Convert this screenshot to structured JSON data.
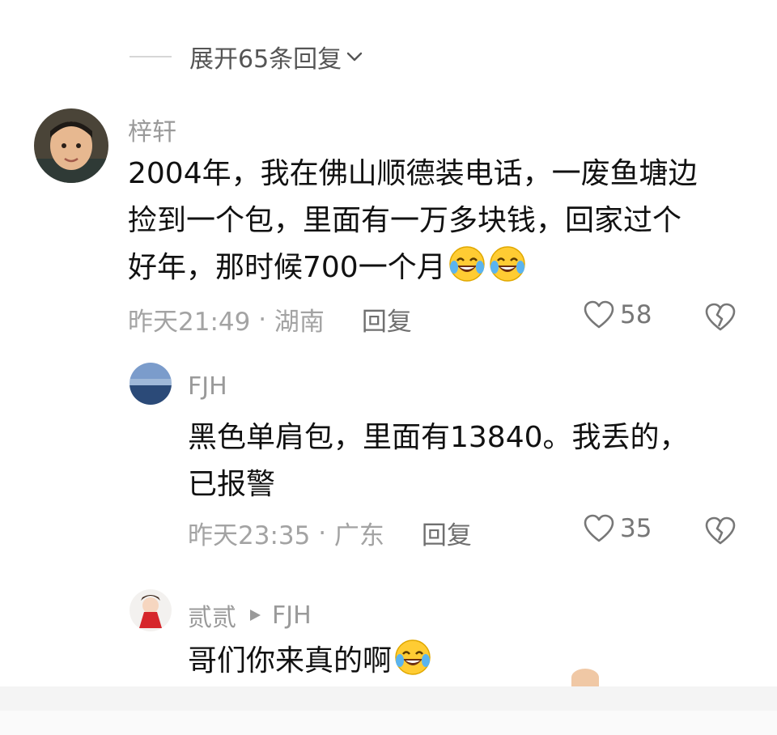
{
  "expand": {
    "label": "展开65条回复"
  },
  "comment": {
    "user": "梓轩",
    "text_lines": [
      "2004年，我在佛山顺德装电话，一废鱼塘边",
      "捡到一个包，里面有一万多块钱，回家过个",
      "好年，那时候700一个月"
    ],
    "time": "昨天21:49",
    "location": "湖南",
    "reply_label": "回复",
    "likes": "58"
  },
  "reply1": {
    "user": "FJH",
    "text_lines": [
      "黑色单肩包，里面有13840。我丢的，",
      "已报警"
    ],
    "time": "昨天23:35",
    "location": "广东",
    "reply_label": "回复",
    "likes": "35"
  },
  "reply2": {
    "user": "贰贰",
    "target": "FJH",
    "text": "哥们你来真的啊"
  },
  "colors": {
    "text": "#111111",
    "meta": "#a3a3a3",
    "emoji": "#ffcc33"
  },
  "icons": [
    "chevron-down-icon",
    "heart-icon",
    "broken-heart-icon",
    "laugh-cry-emoji",
    "play-arrow-icon"
  ]
}
